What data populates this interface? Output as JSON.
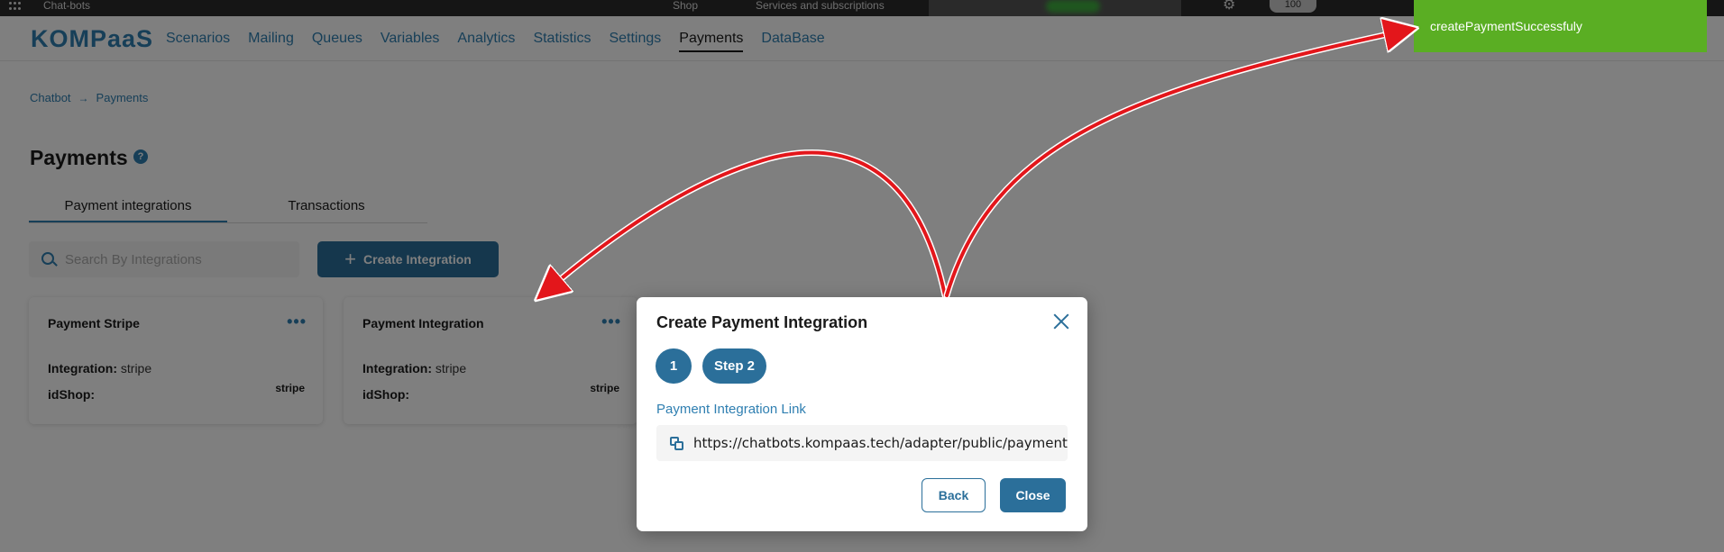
{
  "topbar": {
    "app_name": "Chat-bots",
    "shop": "Shop",
    "services": "Services and subscriptions",
    "badge": "100"
  },
  "nav": {
    "logo": "KOMPaaS",
    "items": [
      {
        "label": "Scenarios"
      },
      {
        "label": "Mailing"
      },
      {
        "label": "Queues"
      },
      {
        "label": "Variables"
      },
      {
        "label": "Analytics"
      },
      {
        "label": "Statistics"
      },
      {
        "label": "Settings"
      },
      {
        "label": "Payments",
        "active": true
      },
      {
        "label": "DataBase"
      }
    ]
  },
  "breadcrumb": {
    "root": "Chatbot",
    "current": "Payments"
  },
  "page": {
    "title": "Payments",
    "help": "?"
  },
  "tabs": [
    {
      "label": "Payment integrations",
      "active": true
    },
    {
      "label": "Transactions"
    }
  ],
  "search": {
    "placeholder": "Search By Integrations"
  },
  "create_button": {
    "icon": "plus-icon",
    "label": "Create Integration"
  },
  "cards": [
    {
      "title": "Payment Stripe",
      "integration_label": "Integration:",
      "integration_value": "stripe",
      "idshop_label": "idShop:",
      "tag": "stripe"
    },
    {
      "title": "Payment Integration",
      "integration_label": "Integration:",
      "integration_value": "stripe",
      "idshop_label": "idShop:",
      "tag": "stripe"
    }
  ],
  "modal": {
    "title": "Create Payment Integration",
    "step1": "1",
    "step2": "Step 2",
    "link_label": "Payment Integration Link",
    "link_value": "https://chatbots.kompaas.tech/adapter/public/payment/wel",
    "back": "Back",
    "close": "Close"
  },
  "toast": {
    "message": "createPaymentSuccessfuly",
    "color": "#5aae23"
  },
  "colors": {
    "accent": "#2b6f9a",
    "link": "#2f7fb1",
    "annotation_arrow": "#e3161b"
  }
}
